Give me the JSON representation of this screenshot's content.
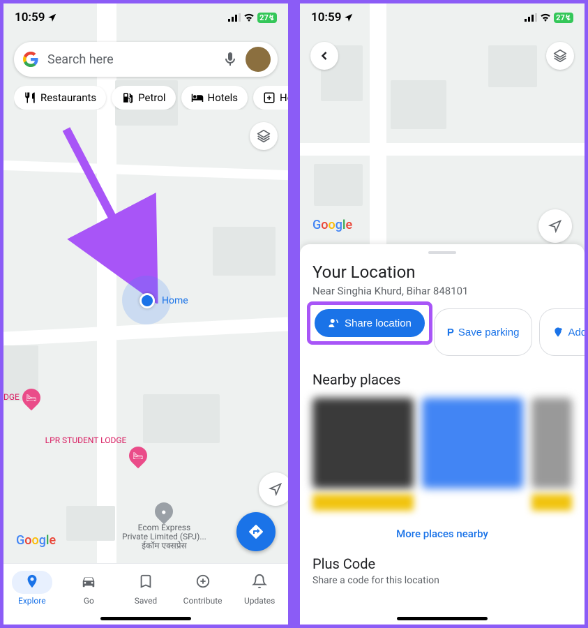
{
  "status": {
    "time": "10:59",
    "battery": "27"
  },
  "search": {
    "placeholder": "Search here"
  },
  "chips": [
    {
      "icon": "utensils",
      "label": "Restaurants"
    },
    {
      "icon": "fuel",
      "label": "Petrol"
    },
    {
      "icon": "bed",
      "label": "Hotels"
    },
    {
      "icon": "plus-box",
      "label": "Hosp"
    }
  ],
  "location_label": "Home",
  "poi": {
    "lodge_partial": "DGE",
    "lodge_name": "LPR STUDENT LODGE",
    "ecom_line1": "Ecom Express",
    "ecom_line2": "Private Limited (SPJ)...",
    "ecom_line3": "ईकॉम एक्सप्रेस"
  },
  "nav": [
    {
      "label": "Explore",
      "active": true
    },
    {
      "label": "Go",
      "active": false
    },
    {
      "label": "Saved",
      "active": false
    },
    {
      "label": "Contribute",
      "active": false
    },
    {
      "label": "Updates",
      "active": false
    }
  ],
  "panel": {
    "title": "Your Location",
    "subtitle": "Near Singhia Khurd, Bihar 848101",
    "actions": {
      "share": "Share location",
      "parking": "Save parking",
      "add": "Add"
    },
    "nearby_title": "Nearby places",
    "more_link": "More places nearby",
    "plus_title": "Plus Code",
    "plus_sub": "Share a code for this location"
  }
}
